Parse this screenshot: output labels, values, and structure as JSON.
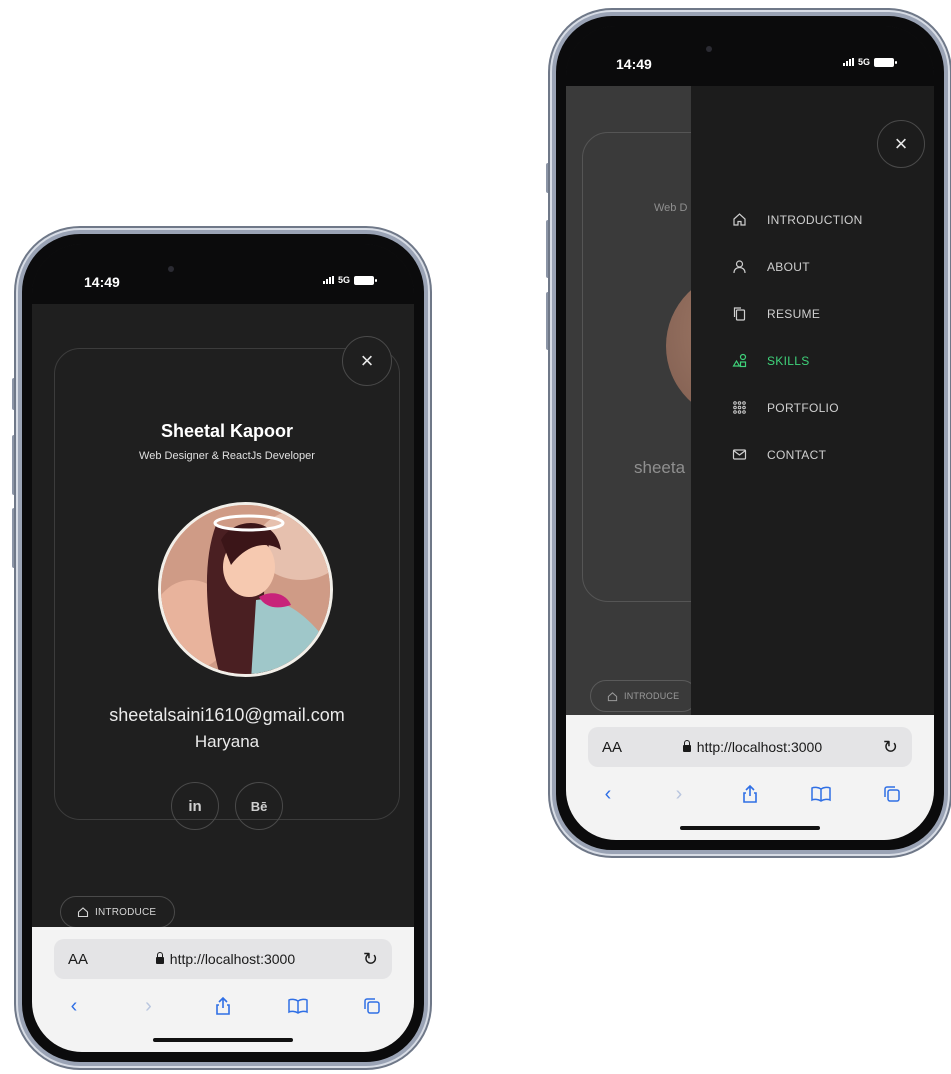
{
  "phone_left": {
    "status": {
      "time": "14:49",
      "network": "5G"
    },
    "profile": {
      "name": "Sheetal Kapoor",
      "role": "Web Designer & ReactJs Developer",
      "email": "sheetalsaini1610@gmail.com",
      "location": "Haryana",
      "socials": [
        {
          "label": "in",
          "icon": "linkedin-icon"
        },
        {
          "label": "Bē",
          "icon": "behance-icon"
        }
      ]
    },
    "close_label": "×",
    "introduce_label": "INTRODUCE",
    "browser": {
      "aa": "AA",
      "url": "http://localhost:3000"
    }
  },
  "phone_right": {
    "status": {
      "time": "14:49",
      "network": "5G"
    },
    "close_label": "×",
    "background": {
      "role_partial": "Web D",
      "name_partial": "sheeta",
      "introduce_label": "INTRODUCE"
    },
    "menu": [
      {
        "label": "INTRODUCTION",
        "icon": "home-icon",
        "active": false
      },
      {
        "label": "ABOUT",
        "icon": "user-icon",
        "active": false
      },
      {
        "label": "RESUME",
        "icon": "documents-icon",
        "active": false
      },
      {
        "label": "SKILLS",
        "icon": "shapes-icon",
        "active": true
      },
      {
        "label": "PORTFOLIO",
        "icon": "grid-icon",
        "active": false
      },
      {
        "label": "CONTACT",
        "icon": "mail-icon",
        "active": false
      }
    ],
    "browser": {
      "aa": "AA",
      "url": "http://localhost:3000"
    }
  },
  "colors": {
    "accent_active": "#3fd27a",
    "safari_blue": "#2f6fe5",
    "app_bg": "#1f1f1f"
  }
}
